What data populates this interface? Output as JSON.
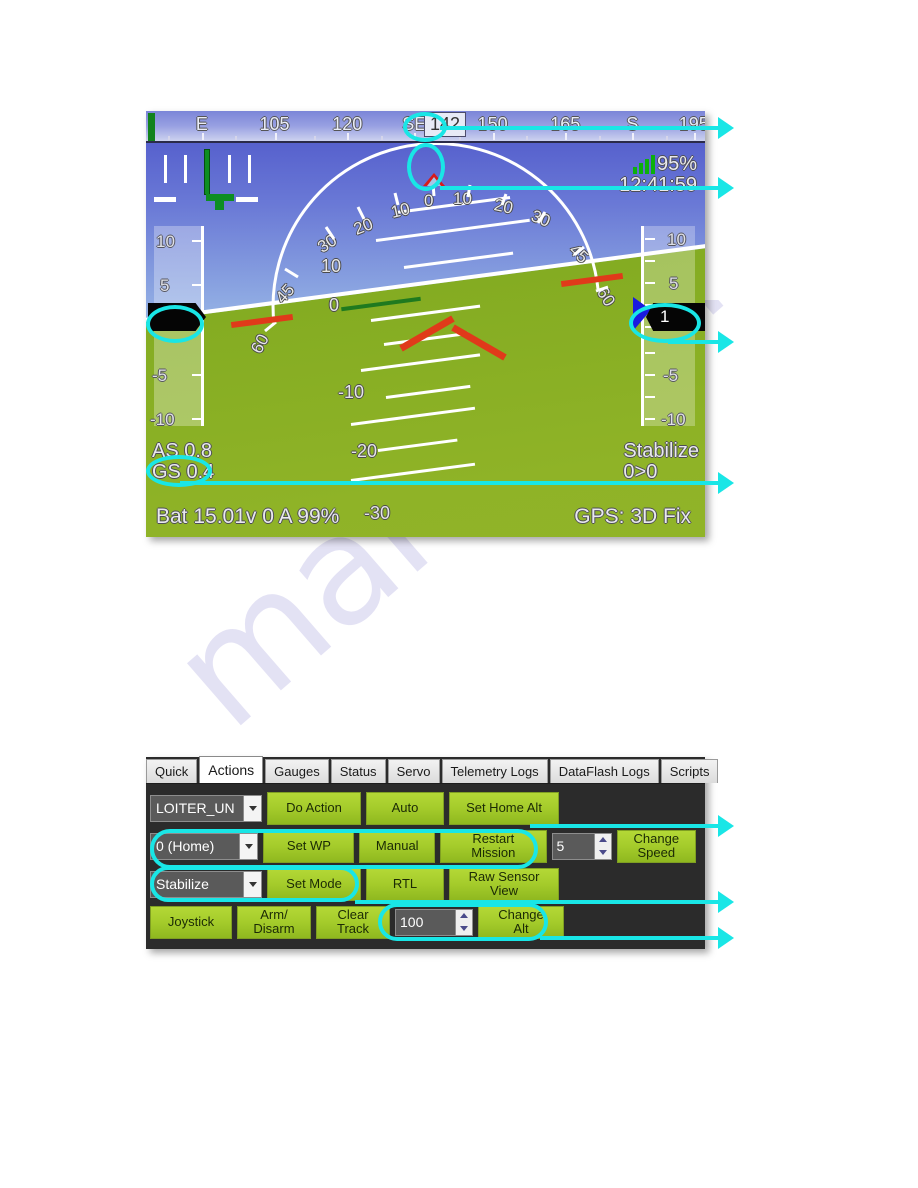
{
  "watermark": {
    "text": "manualshive.com"
  },
  "hud": {
    "heading_tape": {
      "labels": [
        {
          "text": "E",
          "pos": 10
        },
        {
          "text": "105",
          "pos": 23
        },
        {
          "text": "120",
          "pos": 36
        },
        {
          "text": "SE",
          "pos": 48
        },
        {
          "text": "150",
          "pos": 62
        },
        {
          "text": "165",
          "pos": 75
        },
        {
          "text": "S",
          "pos": 87
        },
        {
          "text": "195",
          "pos": 98
        }
      ],
      "current_heading": "142"
    },
    "roll_scale": {
      "ticks_left": [
        "30",
        "20",
        "10"
      ],
      "ticks_right": [
        "20",
        "30"
      ],
      "ticks_outer_left": [
        "60",
        "45"
      ],
      "ticks_outer_right": [
        "45",
        "60"
      ],
      "center": "0",
      "right_first": "10"
    },
    "pitch_ladder": {
      "above": [
        "10"
      ],
      "zero": "0",
      "below": [
        "-10",
        "-20",
        "-30"
      ]
    },
    "speed_tape": {
      "labels": [
        "10",
        "5",
        "-5",
        "-10"
      ],
      "value": ""
    },
    "alt_tape": {
      "labels": [
        "10",
        "5",
        "-5",
        "-10"
      ],
      "value": "1"
    },
    "signal": {
      "percent": "95%",
      "clock": "12:41:59",
      "bars": 4
    },
    "airspeed": "AS 0.8",
    "groundspeed": "GS 0.4",
    "mode": "Stabilize",
    "wp_progress": "0>0",
    "battery": "Bat 15.01v 0 A 99%",
    "gps": "GPS: 3D Fix"
  },
  "panel": {
    "tabs": [
      {
        "label": "Quick",
        "active": false
      },
      {
        "label": "Actions",
        "active": true
      },
      {
        "label": "Gauges",
        "active": false
      },
      {
        "label": "Status",
        "active": false
      },
      {
        "label": "Servo",
        "active": false
      },
      {
        "label": "Telemetry Logs",
        "active": false
      },
      {
        "label": "DataFlash Logs",
        "active": false
      },
      {
        "label": "Scripts",
        "active": false
      }
    ],
    "row1": {
      "command_select": "LOITER_UN",
      "do_action": "Do Action",
      "auto": "Auto",
      "set_home_alt": "Set Home Alt"
    },
    "row2": {
      "wp_select": "0 (Home)",
      "set_wp": "Set WP",
      "manual": "Manual",
      "restart_mission": "Restart\nMission",
      "speed_value": "5",
      "change_speed": "Change\nSpeed"
    },
    "row3": {
      "mode_select": "Stabilize",
      "set_mode": "Set Mode",
      "rtl": "RTL",
      "raw_sensor_view": "Raw Sensor\nView"
    },
    "row4": {
      "joystick": "Joystick",
      "arm_disarm": "Arm/\nDisarm",
      "clear_track": "Clear\nTrack",
      "alt_value": "100",
      "change_alt": "Change\nAlt"
    }
  },
  "colors": {
    "highlight": "#19e6e6",
    "button_green": "#a5cc2b",
    "panel_bg": "#2b2b2b"
  }
}
